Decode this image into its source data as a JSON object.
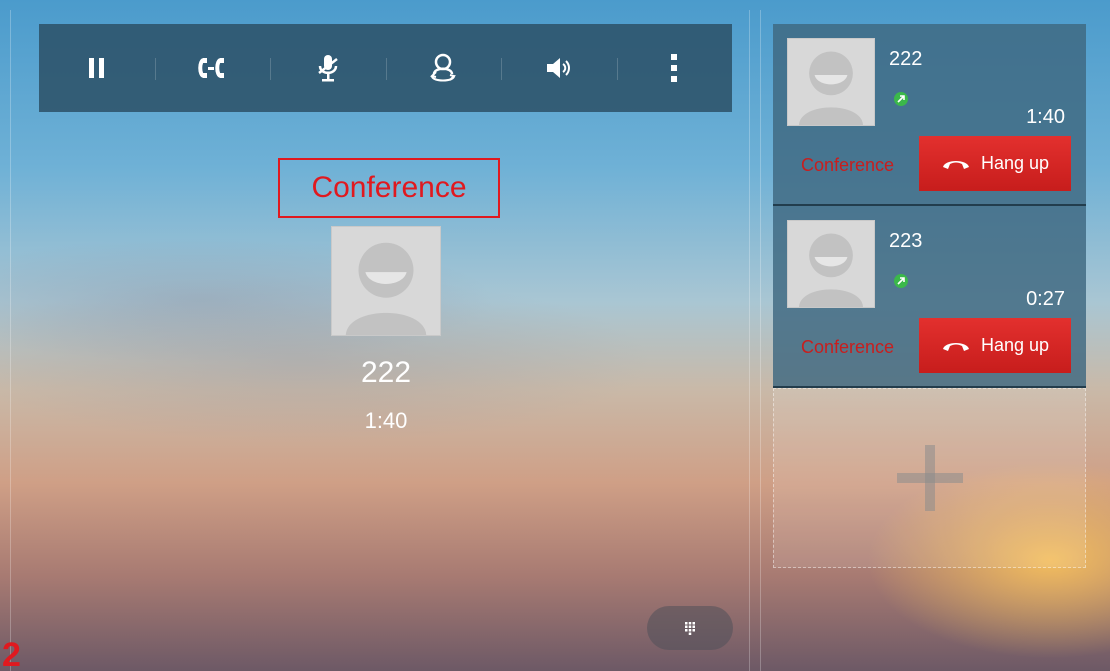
{
  "page_indicator": "2",
  "toolbar": {
    "items": [
      {
        "icon": "hold-icon"
      },
      {
        "icon": "transfer-icon"
      },
      {
        "icon": "mute-icon"
      },
      {
        "icon": "conference-icon"
      },
      {
        "icon": "volume-icon"
      },
      {
        "icon": "more-icon"
      }
    ]
  },
  "main_call": {
    "status_label": "Conference",
    "number": "222",
    "duration": "1:40"
  },
  "calls": [
    {
      "number": "222",
      "duration": "1:40",
      "conference_label": "Conference",
      "hangup_label": "Hang up",
      "status_color": "#3bb84a"
    },
    {
      "number": "223",
      "duration": "0:27",
      "conference_label": "Conference",
      "hangup_label": "Hang up",
      "status_color": "#3bb84a"
    }
  ],
  "add_slot": {
    "icon": "plus-icon"
  },
  "colors": {
    "accent_red": "#e0191f",
    "hangup_red": "#d62624",
    "toolbar_bg": "#2c5066",
    "status_green": "#3bb84a"
  }
}
